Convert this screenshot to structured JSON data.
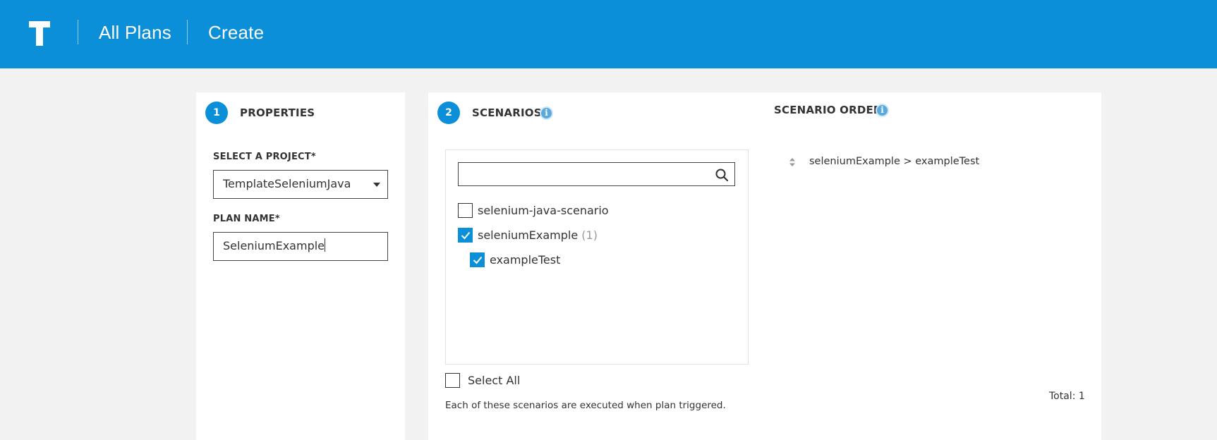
{
  "header": {
    "logo": "T",
    "breadcrumbs": [
      "All Plans",
      "Create"
    ],
    "brand_color": "#0b8fd8"
  },
  "properties": {
    "step": "1",
    "title": "PROPERTIES",
    "project_label": "SELECT A PROJECT*",
    "project_value": "TemplateSeleniumJava",
    "plan_name_label": "PLAN NAME*",
    "plan_name_value": "SeleniumExample"
  },
  "scenarios": {
    "step": "2",
    "title": "SCENARIOS",
    "info_icon": "info-icon",
    "search_value": "",
    "items": [
      {
        "label": "selenium-java-scenario",
        "checked": false,
        "count": ""
      },
      {
        "label": "seleniumExample",
        "checked": true,
        "count": "(1)"
      },
      {
        "label": "exampleTest",
        "checked": true,
        "count": ""
      }
    ],
    "select_all_label": "Select All",
    "help_text": "Each of these scenarios are executed when plan triggered."
  },
  "scenario_order": {
    "title": "SCENARIO ORDER",
    "items": [
      "seleniumExample > exampleTest"
    ],
    "total": "Total: 1"
  }
}
